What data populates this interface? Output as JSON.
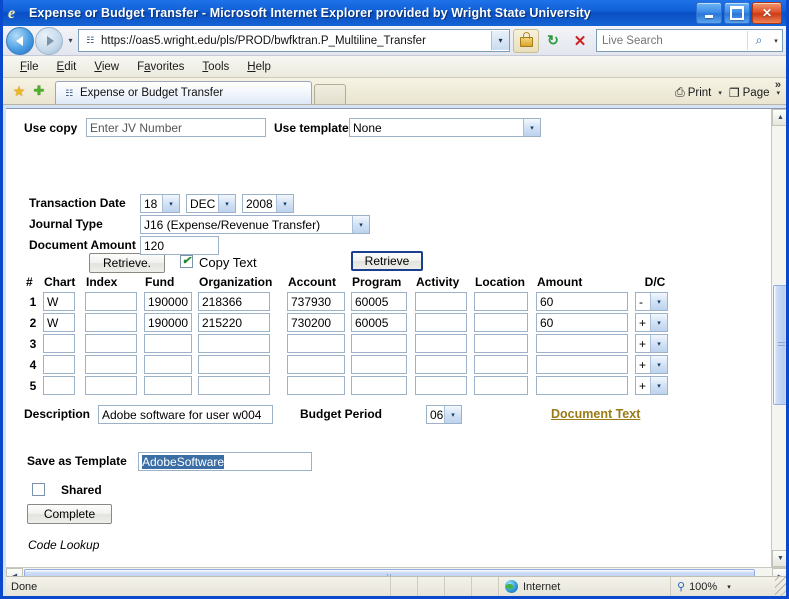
{
  "window": {
    "title": "Expense or Budget Transfer - Microsoft Internet Explorer provided by Wright State University",
    "icon": "ie-logo-icon",
    "minimize_label": "Minimize",
    "maximize_label": "Maximize",
    "close_label": "Close"
  },
  "navbar": {
    "back_label": "Back",
    "forward_label": "Forward",
    "history_caret": "▾",
    "url": "https://oas5.wright.edu/pls/PROD/bwfktran.P_Multiline_Transfer",
    "url_caret": "▾",
    "lock_label": "Security Report",
    "refresh_glyph": "↻",
    "stop_glyph": "✕",
    "search_placeholder": "Live Search",
    "search_value": "",
    "search_glyph": "⌕",
    "search_caret": "▾"
  },
  "menubar": {
    "items": [
      {
        "pre": "",
        "accel": "F",
        "post": "ile"
      },
      {
        "pre": "",
        "accel": "E",
        "post": "dit"
      },
      {
        "pre": "",
        "accel": "V",
        "post": "iew"
      },
      {
        "pre": "F",
        "accel": "a",
        "post": "vorites"
      },
      {
        "pre": "",
        "accel": "T",
        "post": "ools"
      },
      {
        "pre": "",
        "accel": "H",
        "post": "elp"
      }
    ]
  },
  "tabbar": {
    "favorites_center_label": "Favorites Center",
    "add_favorite_label": "Add to Favorites",
    "star_glyph": "★",
    "plus_glyph": "✚",
    "active_tab_label": "Expense or Budget Transfer",
    "new_tab_label": "New Tab",
    "print_label": "Print",
    "print_glyph": "⎙",
    "page_label": "Page",
    "page_glyph": "❐",
    "caret": "▾",
    "overflow_glyph": "»"
  },
  "form": {
    "use_copy_label": "Use copy",
    "use_copy_value": "Enter JV Number",
    "use_template_label": "Use template",
    "use_template_value": "None",
    "retrieve_copy_label": "Retrieve.",
    "copy_text_label": "Copy Text",
    "copy_text_checked": true,
    "copy_text_tick": "✔",
    "retrieve_template_label": "Retrieve",
    "transaction_date_label": "Transaction Date",
    "transaction_day": "18",
    "transaction_month": "DEC",
    "transaction_year": "2008",
    "journal_type_label": "Journal Type",
    "journal_type_value": "J16 (Expense/Revenue Transfer)",
    "document_amount_label": "Document Amount",
    "document_amount_value": "120",
    "description_label": "Description",
    "description_value": "Adobe software for user w004",
    "budget_period_label": "Budget Period",
    "budget_period_value": "06",
    "document_text_link": "Document Text",
    "save_as_template_label": "Save as Template",
    "save_as_template_value": "AdobeSoftware",
    "save_as_template_selected": true,
    "shared_label": "Shared",
    "shared_checked": false,
    "complete_label": "Complete",
    "code_lookup_label": "Code Lookup",
    "select_caret": "▾"
  },
  "grid": {
    "headers": [
      "#",
      "Chart",
      "Index",
      "Fund",
      "Organization",
      "Account",
      "Program",
      "Activity",
      "Location",
      "Amount",
      "D/C"
    ],
    "rows": [
      {
        "num": "1",
        "chart": "W",
        "index": "",
        "fund": "190000",
        "organization": "218366",
        "account": "737930",
        "program": "60005",
        "activity": "",
        "location": "",
        "amount": "60",
        "dc": "-"
      },
      {
        "num": "2",
        "chart": "W",
        "index": "",
        "fund": "190000",
        "organization": "215220",
        "account": "730200",
        "program": "60005",
        "activity": "",
        "location": "",
        "amount": "60",
        "dc": "+"
      },
      {
        "num": "3",
        "chart": "",
        "index": "",
        "fund": "",
        "organization": "",
        "account": "",
        "program": "",
        "activity": "",
        "location": "",
        "amount": "",
        "dc": "+"
      },
      {
        "num": "4",
        "chart": "",
        "index": "",
        "fund": "",
        "organization": "",
        "account": "",
        "program": "",
        "activity": "",
        "location": "",
        "amount": "",
        "dc": "+"
      },
      {
        "num": "5",
        "chart": "",
        "index": "",
        "fund": "",
        "organization": "",
        "account": "",
        "program": "",
        "activity": "",
        "location": "",
        "amount": "",
        "dc": "+"
      }
    ]
  },
  "scrollbars": {
    "up_glyph": "▲",
    "down_glyph": "▼",
    "left_glyph": "◀",
    "right_glyph": "▶"
  },
  "statusbar": {
    "status": "Done",
    "zone": "Internet",
    "zone_icon": "globe-icon",
    "zoom": "100%",
    "zoom_icon": "magnifier-icon",
    "zoom_caret": "▾"
  },
  "colors": {
    "titlebar_blue": "#0a4fc4",
    "frame_blue": "#0b49cc",
    "link_gold": "#9a7b16",
    "selection_blue": "#3b6ea5",
    "input_border": "#9db2c6"
  }
}
